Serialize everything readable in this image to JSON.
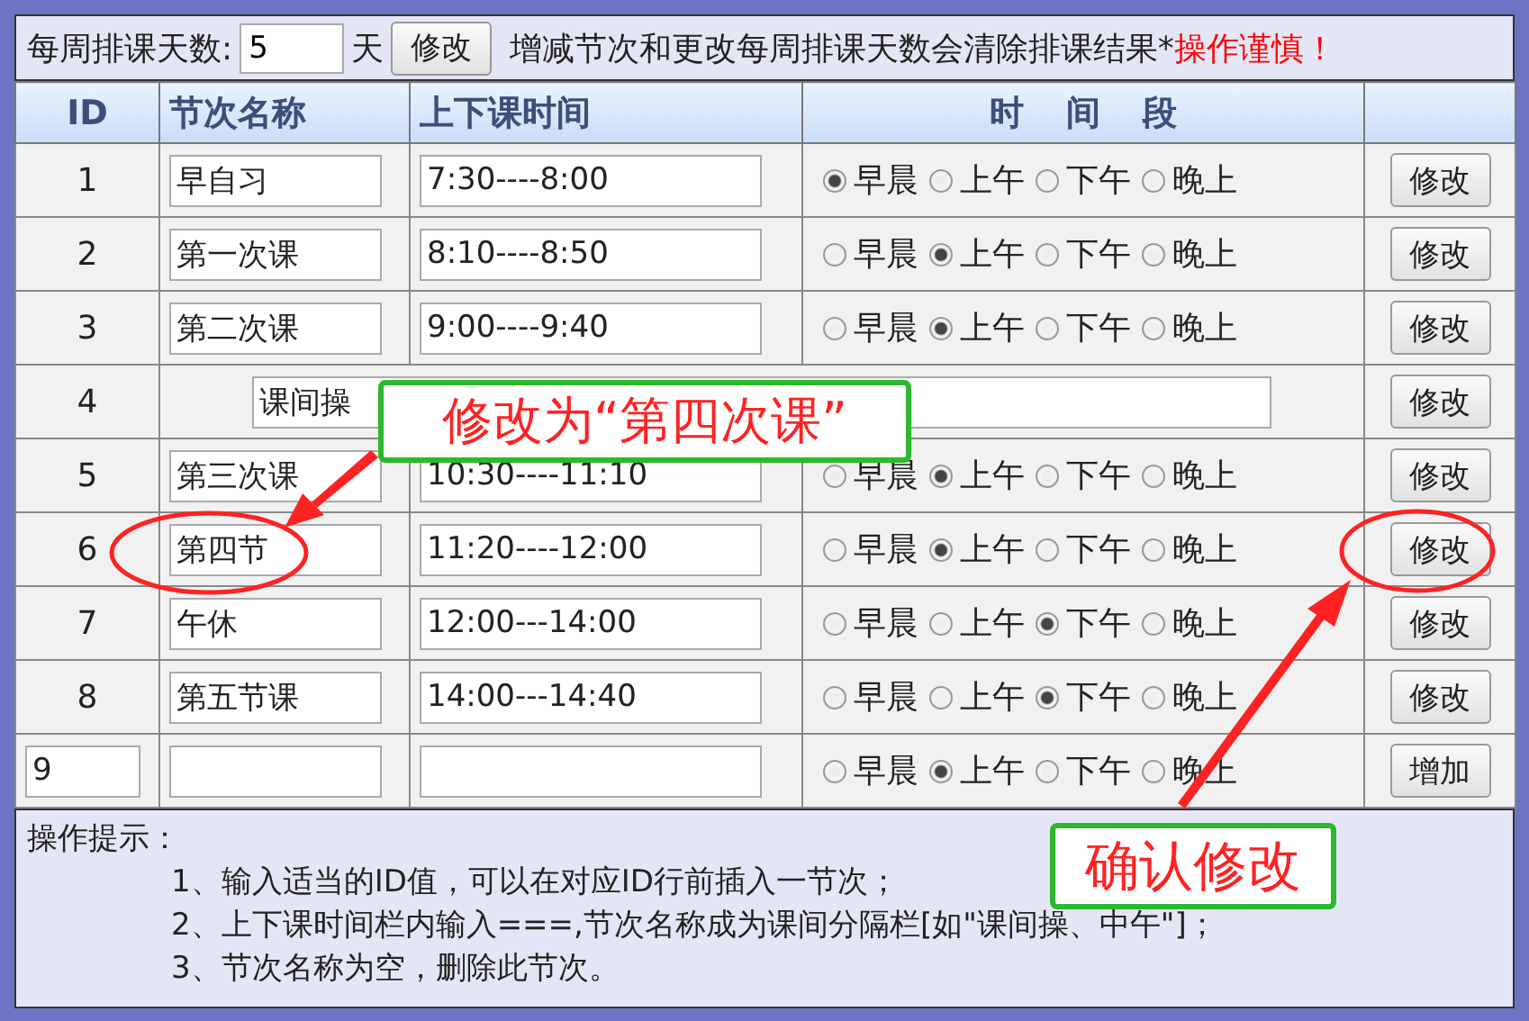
{
  "settings": {
    "label": "每周排课天数:",
    "days": "5",
    "unit": "天",
    "button": "修改",
    "warning": "增减节次和更改每周排课天数会清除排课结果*",
    "caution": "操作谨慎！"
  },
  "columns": [
    "ID",
    "节次名称",
    "上下课时间",
    "时 间 段"
  ],
  "rows": [
    {
      "kind": "period",
      "id": "1",
      "name": "早自习",
      "time": "7:30----8:00",
      "periods": [
        {
          "label": "早晨",
          "selected": true
        },
        {
          "label": "上午",
          "selected": false
        },
        {
          "label": "下午",
          "selected": false
        },
        {
          "label": "晚上",
          "selected": false
        }
      ],
      "button": "修改"
    },
    {
      "kind": "period",
      "id": "2",
      "name": "第一次课",
      "time": "8:10----8:50",
      "periods": [
        {
          "label": "早晨",
          "selected": false
        },
        {
          "label": "上午",
          "selected": true
        },
        {
          "label": "下午",
          "selected": false
        },
        {
          "label": "晚上",
          "selected": false
        }
      ],
      "button": "修改"
    },
    {
      "kind": "period",
      "id": "3",
      "name": "第二次课",
      "time": "9:00----9:40",
      "periods": [
        {
          "label": "早晨",
          "selected": false
        },
        {
          "label": "上午",
          "selected": true
        },
        {
          "label": "下午",
          "selected": false
        },
        {
          "label": "晚上",
          "selected": false
        }
      ],
      "button": "修改"
    },
    {
      "kind": "break",
      "id": "4",
      "name": "课间操",
      "button": "修改"
    },
    {
      "kind": "period",
      "id": "5",
      "name": "第三次课",
      "time": "10:30----11:10",
      "periods": [
        {
          "label": "早晨",
          "selected": false
        },
        {
          "label": "上午",
          "selected": true
        },
        {
          "label": "下午",
          "selected": false
        },
        {
          "label": "晚上",
          "selected": false
        }
      ],
      "button": "修改"
    },
    {
      "kind": "period",
      "id": "6",
      "name": "第四节",
      "time": "11:20----12:00",
      "periods": [
        {
          "label": "早晨",
          "selected": false
        },
        {
          "label": "上午",
          "selected": true
        },
        {
          "label": "下午",
          "selected": false
        },
        {
          "label": "晚上",
          "selected": false
        }
      ],
      "button": "修改"
    },
    {
      "kind": "period",
      "id": "7",
      "name": "午休",
      "time": "12:00---14:00",
      "periods": [
        {
          "label": "早晨",
          "selected": false
        },
        {
          "label": "上午",
          "selected": false
        },
        {
          "label": "下午",
          "selected": true
        },
        {
          "label": "晚上",
          "selected": false
        }
      ],
      "button": "修改"
    },
    {
      "kind": "period",
      "id": "8",
      "name": "第五节课",
      "time": "14:00---14:40",
      "periods": [
        {
          "label": "早晨",
          "selected": false
        },
        {
          "label": "上午",
          "selected": false
        },
        {
          "label": "下午",
          "selected": true
        },
        {
          "label": "晚上",
          "selected": false
        }
      ],
      "button": "修改"
    },
    {
      "kind": "new",
      "id": "9",
      "periods": [
        {
          "label": "早晨",
          "selected": false
        },
        {
          "label": "上午",
          "selected": true
        },
        {
          "label": "下午",
          "selected": false
        },
        {
          "label": "晚上",
          "selected": false
        }
      ],
      "button": "增加"
    }
  ],
  "tips": {
    "title": "操作提示：",
    "items": [
      "1、输入适当的ID值，可以在对应ID行前插入一节次；",
      "2、上下课时间栏内输入===,节次名称成为课间分隔栏[如\"课间操、中午\"]；",
      "3、节次名称为空，删除此节次。"
    ]
  },
  "annotations": [
    {
      "text": "修改为“第四次课”"
    },
    {
      "text": "确认修改"
    }
  ]
}
